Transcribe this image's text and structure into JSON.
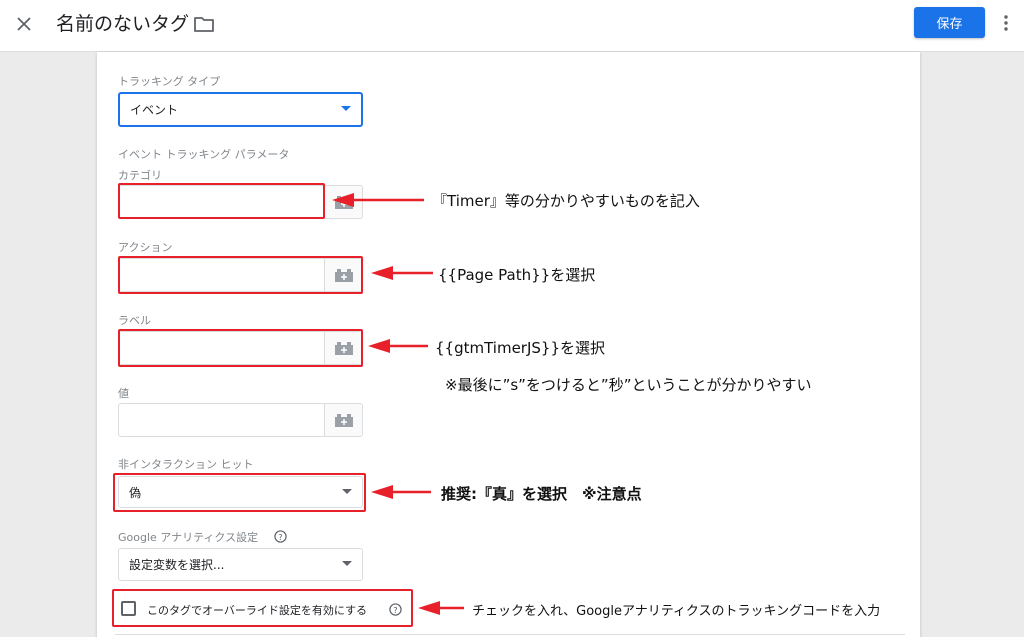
{
  "header": {
    "title": "名前のないタグ",
    "save_label": "保存"
  },
  "form": {
    "tracking_type_label": "トラッキング タイプ",
    "tracking_type_value": "イベント",
    "event_params_label": "イベント トラッキング パラメータ",
    "category_label": "カテゴリ",
    "action_label": "アクション",
    "label_label": "ラベル",
    "value_label": "値",
    "non_interaction_label": "非インタラクション ヒット",
    "non_interaction_value": "偽",
    "ga_settings_label": "Google アナリティクス設定",
    "ga_settings_value": "設定変数を選択...",
    "override_label": "このタグでオーバーライド設定を有効にする"
  },
  "annotations": {
    "category": "『Timer』等の分かりやすいものを記入",
    "action": "{{Page Path}}を選択",
    "label": "{{gtmTimerJS}}を選択",
    "label_note": "※最後に”s”をつけると”秒”ということが分かりやすい",
    "non_interaction": "推奨:『真』を選択　※注意点",
    "override": "チェックを入れ、Googleアナリティクスのトラッキングコードを入力"
  },
  "colors": {
    "accent": "#1a73e8",
    "highlight": "#e8202a"
  }
}
